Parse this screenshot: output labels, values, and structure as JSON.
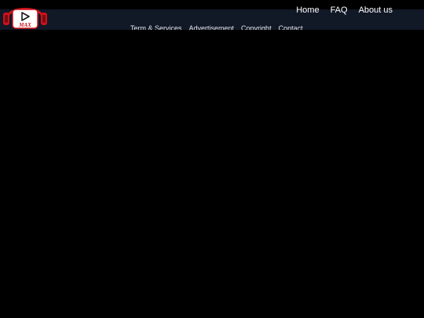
{
  "header": {
    "logo": {
      "text": "MAX",
      "icon": "headphones-play-icon",
      "brand_color": "#d0121b"
    },
    "primary_nav": {
      "items": [
        {
          "label": "Home"
        },
        {
          "label": "FAQ"
        },
        {
          "label": "About us"
        }
      ]
    },
    "secondary_nav": {
      "items": [
        {
          "label": "Term & Services"
        },
        {
          "label": "Advertisement"
        },
        {
          "label": "Copyright"
        },
        {
          "label": "Contact"
        }
      ]
    }
  },
  "colors": {
    "page_background": "#000000",
    "header_background": "#111826",
    "nav_text": "#ffffff"
  }
}
